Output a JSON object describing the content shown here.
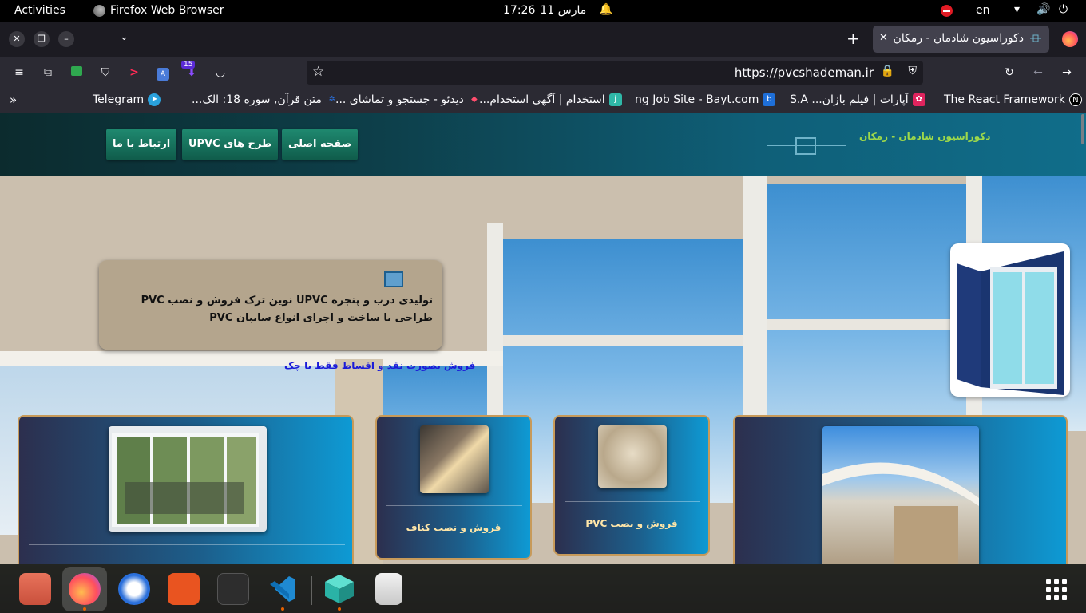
{
  "system": {
    "activities": "Activities",
    "app_name": "Firefox Web Browser",
    "clock_time": "17:26",
    "clock_date": "مارس 11",
    "keyboard_lang": "en"
  },
  "browser": {
    "tab_title": "دکوراسیون شادمان - رمکان",
    "url": "https://pvcshademan.ir",
    "extension_badge": "15",
    "bookmarks": [
      {
        "label": "The React Framework",
        "icon": "nextjs-icon",
        "color": "#000000"
      },
      {
        "label": "آپارات | فیلم بازان... S.A",
        "icon": "aparat-icon",
        "color": "#e0245e"
      },
      {
        "label": "ng Job Site - Bayt.com",
        "icon": "bayt-icon",
        "color": "#1e6fd9"
      },
      {
        "label": "استخدام | آگهی استخدام...",
        "icon": "jobinja-icon",
        "color": "#2fb8a8"
      },
      {
        "label": "دیدئو - جستجو و تماشای ...",
        "icon": "deedeo-icon",
        "color": "#ff4d6d"
      },
      {
        "label": "متن قرآن, سوره 18: الک...",
        "icon": "quran-icon",
        "color": "#2a6fdb"
      },
      {
        "label": "Telegram",
        "icon": "telegram-icon",
        "color": "#2aa1dc"
      }
    ]
  },
  "site": {
    "brand": "دکوراسیون شادمان - رمکان",
    "menu": {
      "home": "صفحه اصلی",
      "designs": "طرح های UPVC",
      "contact": "ارتباط با ما"
    },
    "hero_caption": "تولیدی درب و پنجره UPVC نوین ترک فروش و نصب PVC طراحی یا ساخت و اجرای انواع سایبان PVC",
    "sale_note": "فروش بصورت نقد و اقساط فقط با چک",
    "cards": {
      "canopy": "",
      "pvc": "فروش و نصب PVC",
      "knauf": "فروش و نصب کناف",
      "upvc": ""
    }
  },
  "dock": {
    "apps": [
      "files-icon",
      "firefox-icon",
      "thunderbird-icon",
      "app-center-icon",
      "terminal-icon",
      "vscode-icon",
      "cube-app-icon",
      "trash-icon"
    ]
  }
}
